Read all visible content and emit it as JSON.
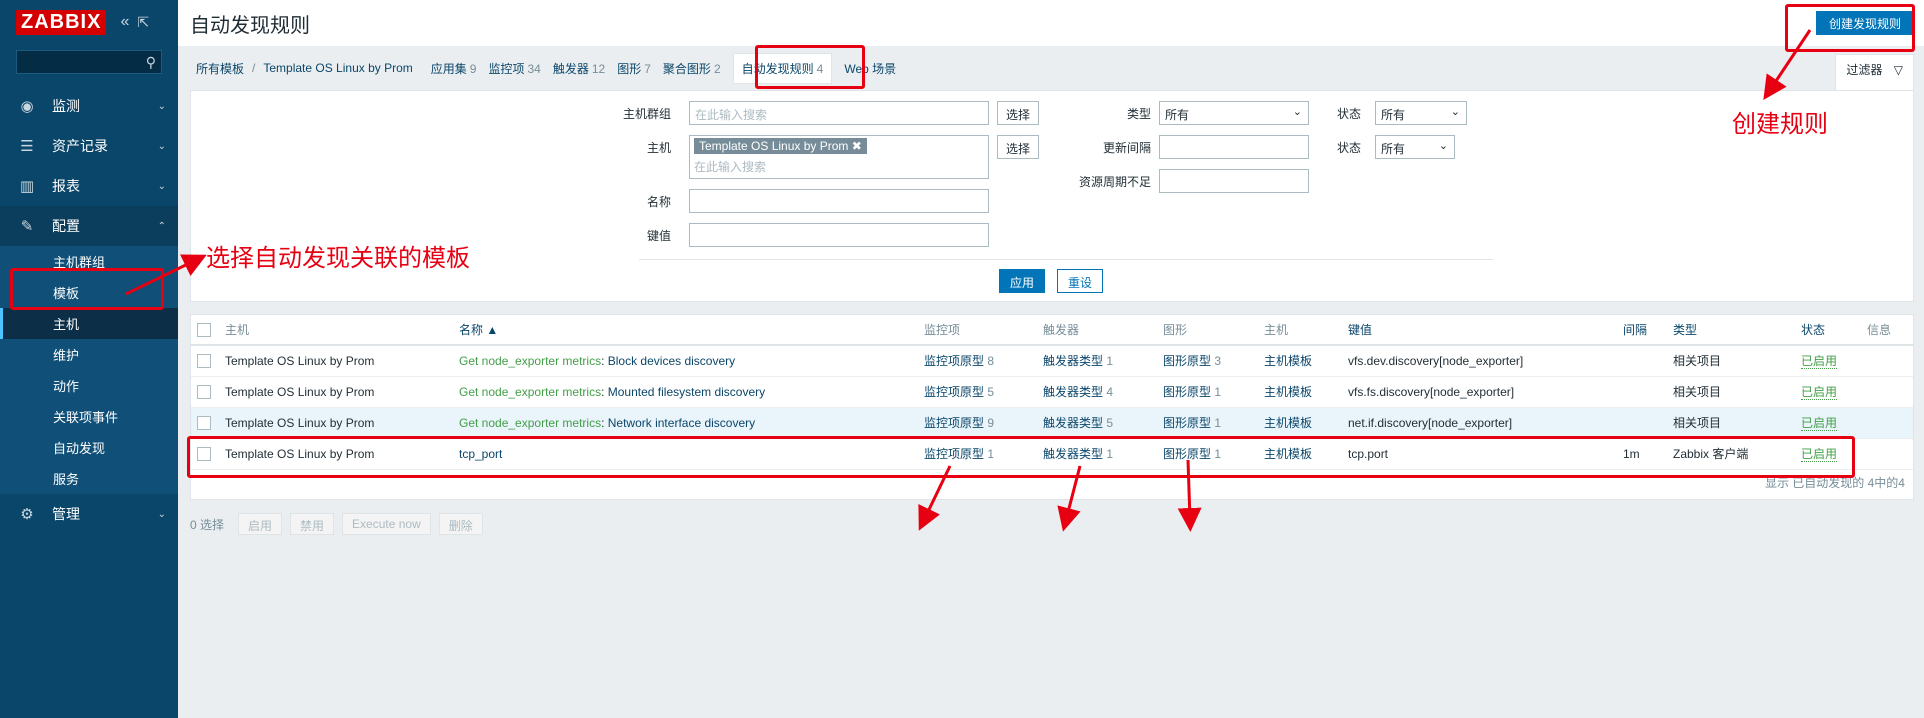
{
  "sidebar": {
    "logo": "ZABBIX",
    "collapse_icon": "«",
    "kiosk_icon": "⇱",
    "menu": [
      {
        "label": "监测",
        "icon": "eye-icon"
      },
      {
        "label": "资产记录",
        "icon": "list-icon"
      },
      {
        "label": "报表",
        "icon": "chart-icon"
      },
      {
        "label": "配置",
        "icon": "wrench-icon"
      },
      {
        "label": "管理",
        "icon": "gear-icon"
      }
    ],
    "submenu": [
      "主机群组",
      "模板",
      "主机",
      "维护",
      "动作",
      "关联项事件",
      "自动发现",
      "服务"
    ]
  },
  "header": {
    "title": "自动发现规则",
    "create_button": "创建发现规则"
  },
  "tabs": {
    "breadcrumb_all": "所有模板",
    "breadcrumb_sep": "/",
    "breadcrumb_template": "Template OS Linux by Prom",
    "items": [
      {
        "label": "应用集",
        "count": "9"
      },
      {
        "label": "监控项",
        "count": "34"
      },
      {
        "label": "触发器",
        "count": "12"
      },
      {
        "label": "图形",
        "count": "7"
      },
      {
        "label": "聚合图形",
        "count": "2"
      },
      {
        "label": "自动发现规则",
        "count": "4"
      },
      {
        "label": "Web 场景",
        "count": ""
      }
    ],
    "filter_label": "过滤器"
  },
  "filter": {
    "host_group_label": "主机群组",
    "host_group_placeholder": "在此输入搜索",
    "select_button": "选择",
    "host_label": "主机",
    "host_chip": "Template OS Linux by Prom",
    "host_placeholder": "在此输入搜索",
    "name_label": "名称",
    "key_label": "键值",
    "type_label": "类型",
    "type_value": "所有",
    "update_interval_label": "更新间隔",
    "keep_lost_label": "资源周期不足",
    "status_label": "状态",
    "status_value": "所有",
    "state_label": "状态",
    "state_value": "所有",
    "apply_button": "应用",
    "reset_button": "重设"
  },
  "table": {
    "headers": {
      "host": "主机",
      "name": "名称 ▲",
      "items": "监控项",
      "triggers": "触发器",
      "graphs": "图形",
      "hosts": "主机",
      "key": "键值",
      "interval": "间隔",
      "type": "类型",
      "status": "状态",
      "info": "信息"
    },
    "rows": [
      {
        "host": "Template OS Linux by Prom",
        "prefix": "Get node_exporter metrics",
        "name": "Block devices discovery",
        "items": "监控项原型",
        "items_cnt": "8",
        "triggers": "触发器类型",
        "triggers_cnt": "1",
        "graphs": "图形原型",
        "graphs_cnt": "3",
        "hosts": "主机模板",
        "key": "vfs.dev.discovery[node_exporter]",
        "interval": "",
        "type": "相关项目",
        "status": "已启用"
      },
      {
        "host": "Template OS Linux by Prom",
        "prefix": "Get node_exporter metrics",
        "name": "Mounted filesystem discovery",
        "items": "监控项原型",
        "items_cnt": "5",
        "triggers": "触发器类型",
        "triggers_cnt": "4",
        "graphs": "图形原型",
        "graphs_cnt": "1",
        "hosts": "主机模板",
        "key": "vfs.fs.discovery[node_exporter]",
        "interval": "",
        "type": "相关项目",
        "status": "已启用"
      },
      {
        "host": "Template OS Linux by Prom",
        "prefix": "Get node_exporter metrics",
        "name": "Network interface discovery",
        "items": "监控项原型",
        "items_cnt": "9",
        "triggers": "触发器类型",
        "triggers_cnt": "5",
        "graphs": "图形原型",
        "graphs_cnt": "1",
        "hosts": "主机模板",
        "key": "net.if.discovery[node_exporter]",
        "interval": "",
        "type": "相关项目",
        "status": "已启用"
      },
      {
        "host": "Template OS Linux by Prom",
        "prefix": "",
        "name": "tcp_port",
        "items": "监控项原型",
        "items_cnt": "1",
        "triggers": "触发器类型",
        "triggers_cnt": "1",
        "graphs": "图形原型",
        "graphs_cnt": "1",
        "hosts": "主机模板",
        "key": "tcp.port",
        "interval": "1m",
        "type": "Zabbix 客户端",
        "status": "已启用"
      }
    ],
    "footer": "显示 已自动发现的 4中的4"
  },
  "actions": {
    "selected": "0 选择",
    "enable": "启用",
    "disable": "禁用",
    "execute": "Execute now",
    "delete": "删除"
  },
  "annotations": {
    "select_template": "选择自动发现关联的模板",
    "create_rule": "创建规则"
  },
  "colors": {
    "sidebar_bg": "#0a466a",
    "accent": "#0275b8",
    "annotation_red": "#e60012",
    "enabled_green": "#429e47"
  }
}
